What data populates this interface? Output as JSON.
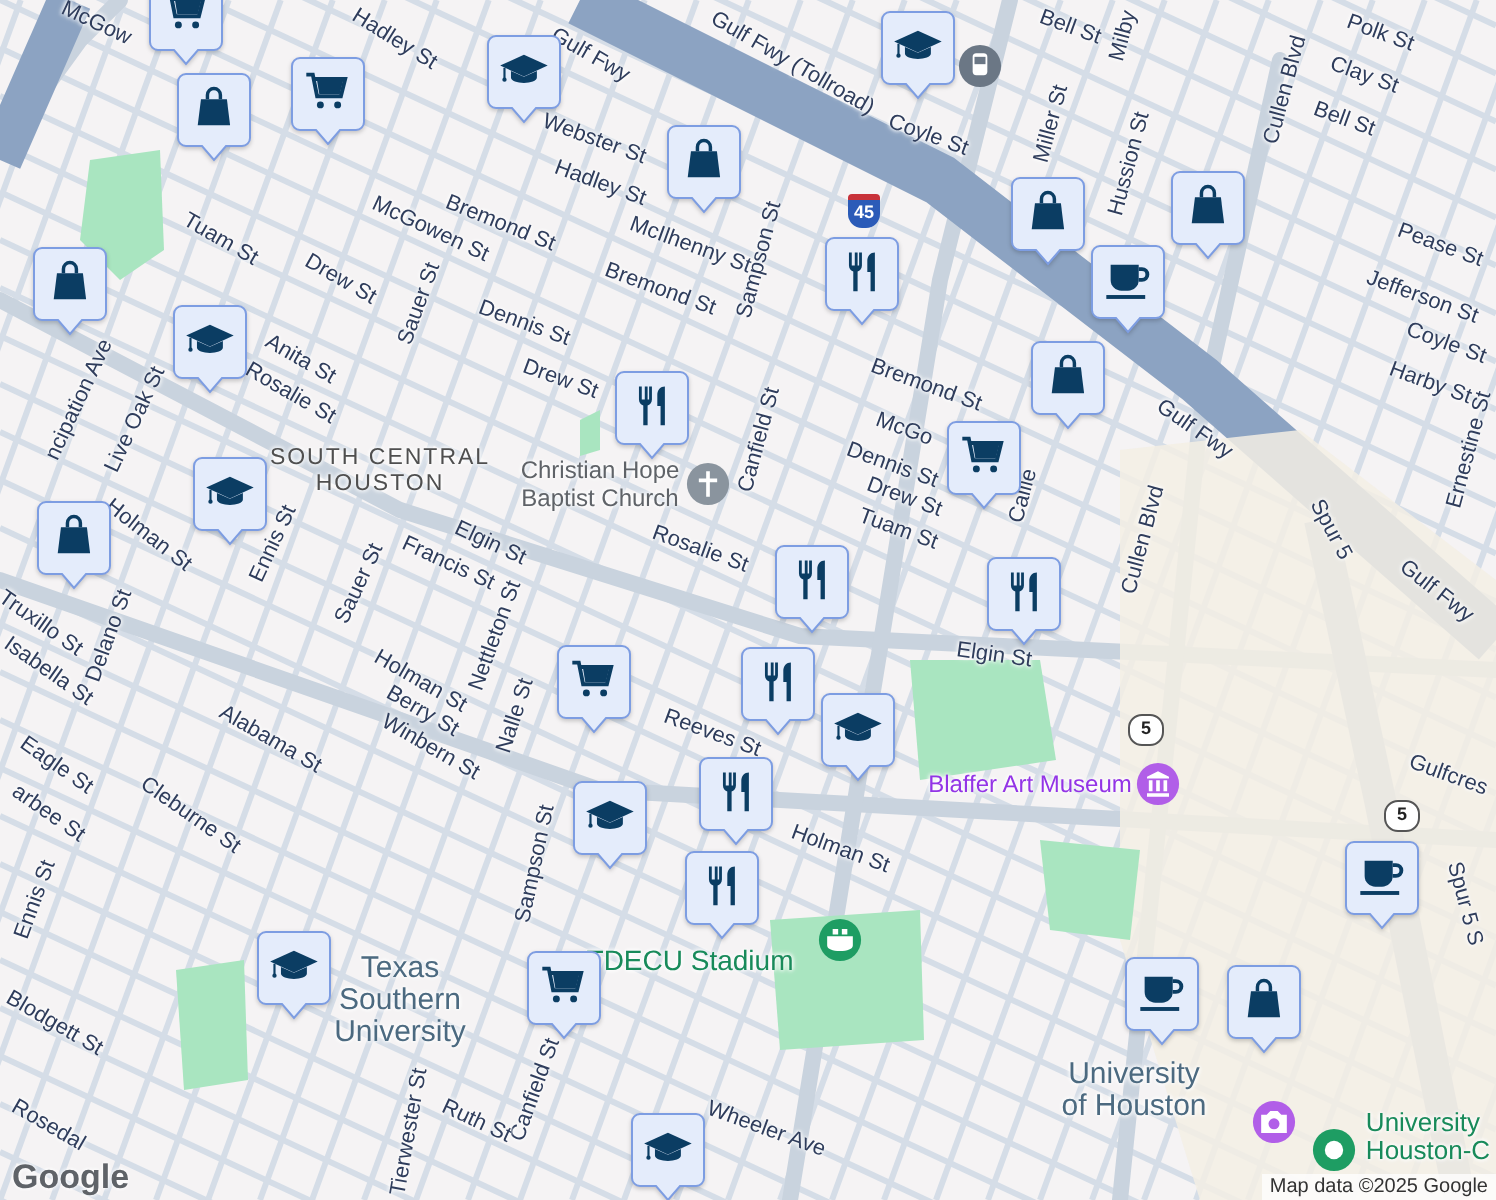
{
  "map": {
    "labels": [
      {
        "text": "McGow",
        "kind": "street"
      },
      {
        "text": "Hadley St",
        "kind": "street"
      },
      {
        "text": "Gulf Fwy",
        "kind": "street"
      },
      {
        "text": "Gulf Fwy (Tollroad)",
        "kind": "street"
      },
      {
        "text": "Webster St",
        "kind": "street"
      },
      {
        "text": "Hadley St",
        "kind": "street"
      },
      {
        "text": "McIlhenny St",
        "kind": "street"
      },
      {
        "text": "Bremond St",
        "kind": "street"
      },
      {
        "text": "Sampson St",
        "kind": "street"
      },
      {
        "text": "Bremond St",
        "kind": "street"
      },
      {
        "text": "Coyle St",
        "kind": "street"
      },
      {
        "text": "Bell St",
        "kind": "street"
      },
      {
        "text": "Milby",
        "kind": "street"
      },
      {
        "text": "Polk St",
        "kind": "street"
      },
      {
        "text": "Clay St",
        "kind": "street"
      },
      {
        "text": "Bell St",
        "kind": "street"
      },
      {
        "text": "Cullen Blvd",
        "kind": "street"
      },
      {
        "text": "Miller St",
        "kind": "street"
      },
      {
        "text": "Hussion St",
        "kind": "street"
      },
      {
        "text": "McGowen St",
        "kind": "street"
      },
      {
        "text": "Tuam St",
        "kind": "street"
      },
      {
        "text": "Drew St",
        "kind": "street"
      },
      {
        "text": "Dennis St",
        "kind": "street"
      },
      {
        "text": "Sauer St",
        "kind": "street"
      },
      {
        "text": "Pease St",
        "kind": "street"
      },
      {
        "text": "Jefferson St",
        "kind": "street"
      },
      {
        "text": "Coyle St",
        "kind": "street"
      },
      {
        "text": "Harby St",
        "kind": "street"
      },
      {
        "text": "Ernestine St",
        "kind": "street"
      },
      {
        "text": "Anita St",
        "kind": "street"
      },
      {
        "text": "Rosalie St",
        "kind": "street"
      },
      {
        "text": "ncipation Ave",
        "kind": "street"
      },
      {
        "text": "Live Oak St",
        "kind": "street"
      },
      {
        "text": "Drew St",
        "kind": "street"
      },
      {
        "text": "Bremond St",
        "kind": "street"
      },
      {
        "text": "McGo",
        "kind": "street"
      },
      {
        "text": "Dennis St",
        "kind": "street"
      },
      {
        "text": "Drew St",
        "kind": "street"
      },
      {
        "text": "Tuam St",
        "kind": "street"
      },
      {
        "text": "Callie",
        "kind": "street"
      },
      {
        "text": "Gulf Fwy",
        "kind": "street"
      },
      {
        "text": "Canfield St",
        "kind": "street"
      },
      {
        "text": "SOUTH CENTRAL\nHOUSTON",
        "kind": "district"
      },
      {
        "text": "Christian Hope\nBaptist Church",
        "kind": "place"
      },
      {
        "text": "Holman St",
        "kind": "street"
      },
      {
        "text": "Ennis St",
        "kind": "street"
      },
      {
        "text": "Elgin St",
        "kind": "street"
      },
      {
        "text": "Rosalie St",
        "kind": "street"
      },
      {
        "text": "Cullen Blvd",
        "kind": "street"
      },
      {
        "text": "Spur 5",
        "kind": "street"
      },
      {
        "text": "Francis St",
        "kind": "street"
      },
      {
        "text": "Sauer St",
        "kind": "street"
      },
      {
        "text": "Gulf Fwy",
        "kind": "street"
      },
      {
        "text": "Truxillo St",
        "kind": "street"
      },
      {
        "text": "Delano St",
        "kind": "street"
      },
      {
        "text": "Nettleton St",
        "kind": "street"
      },
      {
        "text": "Elgin St",
        "kind": "street"
      },
      {
        "text": "Isabella St",
        "kind": "street"
      },
      {
        "text": "Holman St",
        "kind": "street"
      },
      {
        "text": "Berry St",
        "kind": "street"
      },
      {
        "text": "Nalle St",
        "kind": "street"
      },
      {
        "text": "Reeves St",
        "kind": "street"
      },
      {
        "text": "Alabama St",
        "kind": "street"
      },
      {
        "text": "Winbern St",
        "kind": "street"
      },
      {
        "text": "Gulfcres",
        "kind": "street"
      },
      {
        "text": "Eagle St",
        "kind": "street"
      },
      {
        "text": "Blaffer Art Museum",
        "kind": "museum"
      },
      {
        "text": "arbee St",
        "kind": "street"
      },
      {
        "text": "Cleburne St",
        "kind": "street"
      },
      {
        "text": "Holman St",
        "kind": "street"
      },
      {
        "text": "Sampson St",
        "kind": "street"
      },
      {
        "text": "Spur 5 S",
        "kind": "street"
      },
      {
        "text": "Ennis St",
        "kind": "street"
      },
      {
        "text": "Texas\nSouthern\nUniversity",
        "kind": "campus"
      },
      {
        "text": "TDECU Stadium",
        "kind": "stadium"
      },
      {
        "text": "Blodgett St",
        "kind": "street"
      },
      {
        "text": "University\nof Houston",
        "kind": "campus"
      },
      {
        "text": "Tierwester St",
        "kind": "street"
      },
      {
        "text": "Canfield St",
        "kind": "street"
      },
      {
        "text": "Ruth St",
        "kind": "street"
      },
      {
        "text": "Wheeler Ave",
        "kind": "street"
      },
      {
        "text": "University\nHouston-C",
        "kind": "campus-green"
      },
      {
        "text": "Rosedal",
        "kind": "street"
      }
    ],
    "shields": [
      {
        "text": "45",
        "kind": "interstate"
      },
      {
        "text": "5",
        "kind": "state"
      },
      {
        "text": "5",
        "kind": "state"
      }
    ],
    "places": [
      {
        "kind": "church"
      },
      {
        "kind": "museum"
      },
      {
        "kind": "stadium"
      },
      {
        "kind": "photo"
      },
      {
        "kind": "campus"
      },
      {
        "kind": "transit"
      }
    ],
    "markers": [
      {
        "kind": "cart"
      },
      {
        "kind": "bag"
      },
      {
        "kind": "cart"
      },
      {
        "kind": "school"
      },
      {
        "kind": "bag"
      },
      {
        "kind": "school"
      },
      {
        "kind": "food"
      },
      {
        "kind": "bag"
      },
      {
        "kind": "bag"
      },
      {
        "kind": "cafe"
      },
      {
        "kind": "bag"
      },
      {
        "kind": "bag"
      },
      {
        "kind": "school"
      },
      {
        "kind": "food"
      },
      {
        "kind": "cart"
      },
      {
        "kind": "school"
      },
      {
        "kind": "bag"
      },
      {
        "kind": "food"
      },
      {
        "kind": "food"
      },
      {
        "kind": "cart"
      },
      {
        "kind": "food"
      },
      {
        "kind": "school"
      },
      {
        "kind": "food"
      },
      {
        "kind": "school"
      },
      {
        "kind": "food"
      },
      {
        "kind": "school"
      },
      {
        "kind": "cart"
      },
      {
        "kind": "cafe"
      },
      {
        "kind": "cafe"
      },
      {
        "kind": "bag"
      },
      {
        "kind": "school"
      }
    ],
    "logo": "Google",
    "attribution": "Map data ©2025 Google"
  }
}
